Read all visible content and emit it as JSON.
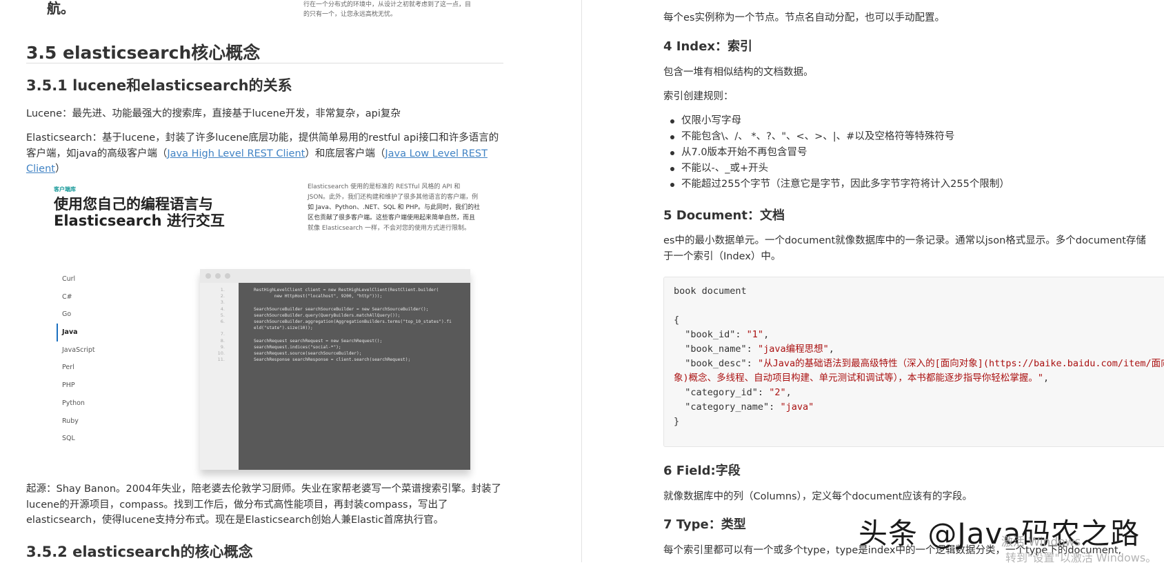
{
  "left": {
    "top_cut_text": "航。",
    "top_cut_small": [
      "行在一个分布式的环境中，从设计之初就考虑到了这一点，目",
      "的只有一个，让您永远高枕无忧。"
    ],
    "heading_35": "3.5 elasticsearch核心概念",
    "heading_351": "3.5.1 lucene和elasticsearch的关系",
    "lucene_para": "Lucene：最先进、功能最强大的搜索库，直接基于lucene开发，非常复杂，api复杂",
    "es_para_pre": "Elasticsearch：基于lucene，封装了许多lucene底层功能，提供简单易用的restful api接口和许多语言的客户端，如java的高级客户端（",
    "es_link_high": "Java High Level REST Client",
    "es_para_mid": "）和底层客户端（",
    "es_link_low": "Java Low Level REST Client",
    "es_para_post": "）",
    "embed": {
      "tag": "客户端库",
      "title_line1": "使用您自己的编程语言与",
      "title_line2": "Elasticsearch 进行交互",
      "desc": [
        "Elasticsearch 使用的是标准的 RESTful 风格的 API 和",
        "JSON。此外，我们还构建和维护了很多其他语言的客户端，例",
        "如 Java、Python、.NET、SQL 和 PHP。与此同时，我们的社",
        "区也贡献了很多客户端。这些客户端使用起来简单自然，而且",
        "就像 Elasticsearch 一样，不会对您的使用方式进行限制。"
      ],
      "languages": [
        "Curl",
        "C#",
        "Go",
        "Java",
        "JavaScript",
        "Perl",
        "PHP",
        "Python",
        "Ruby",
        "SQL"
      ],
      "active_language": "Java",
      "line_numbers": [
        "1.",
        "2.",
        "3.",
        "4.",
        "5.",
        "6.",
        "",
        "7.",
        "8.",
        "9.",
        "10.",
        "11."
      ],
      "code": "RestHighLevelClient client = new RestHighLevelClient(RestClient.builder(\n        new HttpHost(\"localhost\", 9200, \"http\")));\n\nSearchSourceBuilder searchSourceBuilder = new SearchSourceBuilder();\nsearchSourceBuilder.query(QueryBuilders.matchAllQuery());\nsearchSourceBuilder.aggregation(AggregationBuilders.terms(\"top_10_states\").fi\neld(\"state\").size(10));\n\nSearchRequest searchRequest = new SearchRequest();\nsearchRequest.indices(\"social-*\");\nsearchRequest.source(searchSourceBuilder);\nSearchResponse searchResponse = client.search(searchRequest);"
    },
    "origin_para": "起源：Shay Banon。2004年失业，陪老婆去伦敦学习厨师。失业在家帮老婆写一个菜谱搜索引擎。封装了lucene的开源项目，compass。找到工作后，做分布式高性能项目，再封装compass，写出了elasticsearch，使得lucene支持分布式。现在是Elasticsearch创始人兼Elastic首席执行官。",
    "heading_352": "3.5.2 elasticsearch的核心概念"
  },
  "right": {
    "node_para": "每个es实例称为一个节点。节点名自动分配，也可以手动配置。",
    "h_index": "4 Index：索引",
    "index_para": "包含一堆有相似结构的文档数据。",
    "index_rules_title": "索引创建规则：",
    "index_rules": [
      "仅限小写字母",
      "不能包含\\、/、 *、?、\"、<、>、|、#以及空格符等特殊符号",
      "从7.0版本开始不再包含冒号",
      "不能以-、_或+开头",
      "不能超过255个字节（注意它是字节，因此多字节字符将计入255个限制）"
    ],
    "h_document": "5 Document：文档",
    "document_para": "es中的最小数据单元。一个document就像数据库中的一条记录。通常以json格式显示。多个document存储于一个索引（Index）中。",
    "code": {
      "title": "book document",
      "open": "{",
      "k1": "  \"book_id\"",
      "v1": "\"1\"",
      "k2": "  \"book_name\"",
      "v2": "\"java编程思想\"",
      "k3": "  \"book_desc\"",
      "v3": "\"从Java的基础语法到最高级特性（深入的[面向对象](https://baike.baidu.com/item/面向对象)概念、多线程、自动项目构建、单元测试和调试等），本书都能逐步指导你轻松掌握。\"",
      "k4": "  \"category_id\"",
      "v4": "\"2\"",
      "k5": "  \"category_name\"",
      "v5": "\"java\"",
      "close": "}"
    },
    "h_field": "6 Field:字段",
    "field_para": "就像数据库中的列（Columns），定义每个document应该有的字段。",
    "h_type": "7 Type：类型",
    "type_para": "每个索引里都可以有一个或多个type，type是index中的一个逻辑数据分类，一个type下的document,"
  },
  "watermark": "头条 @Java码农之路",
  "activate_line1": "激活 Windows",
  "activate_line2": "转到\"设置\"以激活 Windows。"
}
